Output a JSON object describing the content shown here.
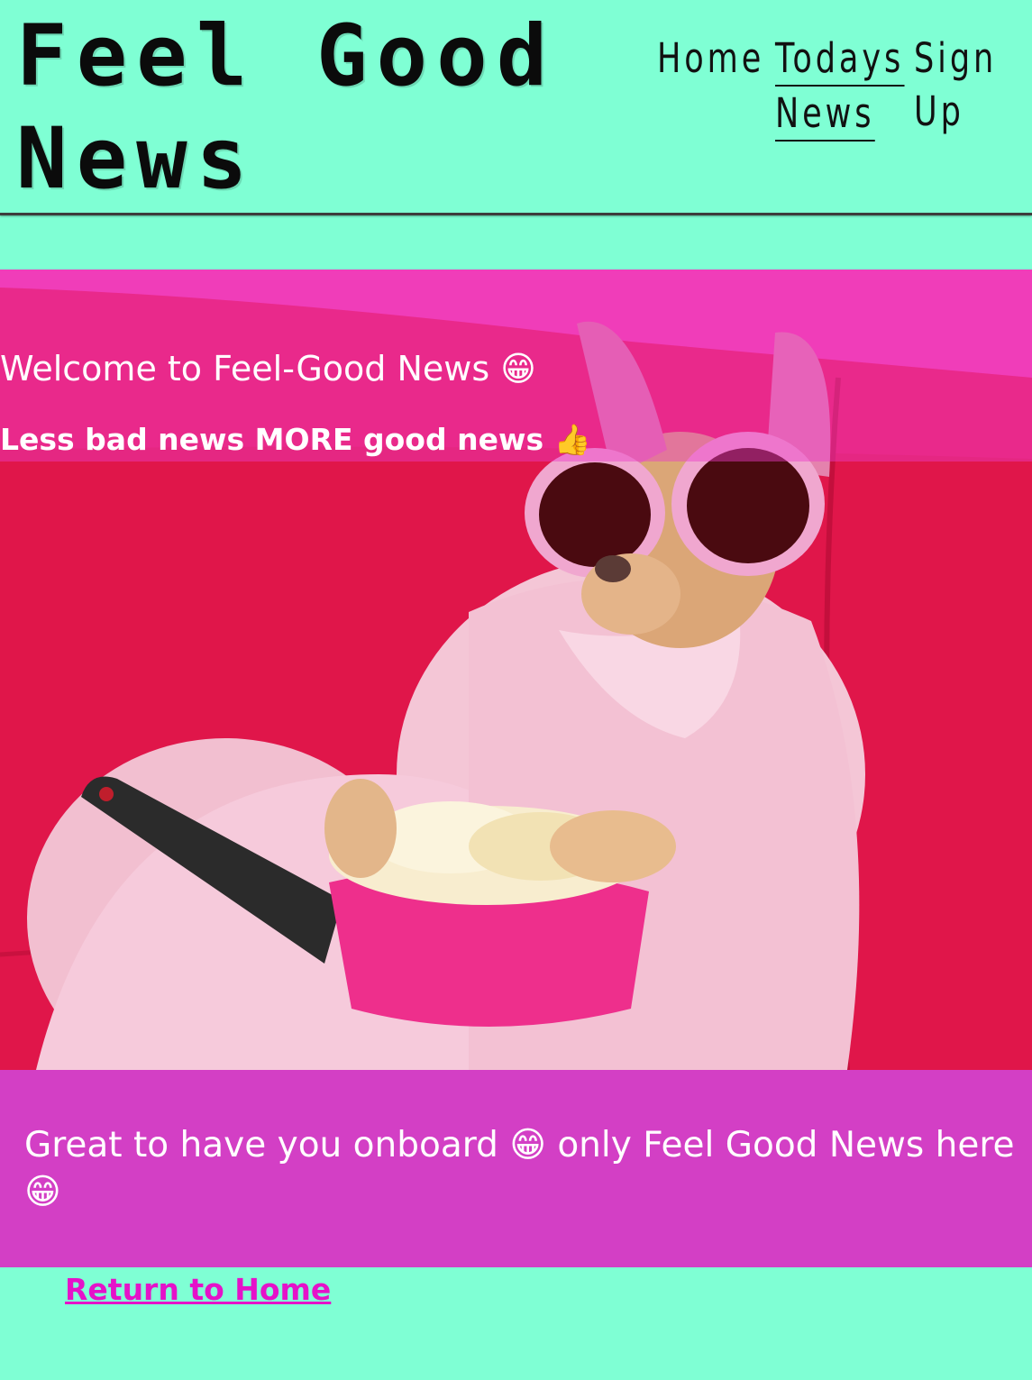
{
  "header": {
    "logo_text": "Feel Good News",
    "nav": {
      "home": "Home",
      "today_line1": "Todays",
      "today_line2": "News",
      "signup_line1": "Sign",
      "signup_line2": "Up"
    }
  },
  "hero": {
    "image_subject": "chihuahua in pink sunglasses and bathrobe holding remote and popcorn on a red sofa",
    "title": "Welcome to Feel-Good News 😁",
    "subtitle": "Less bad news MORE good news 👍"
  },
  "message": {
    "text": "Great to have you onboard 😁 only Feel Good News here 😁"
  },
  "links": {
    "return_home": "Return to Home"
  },
  "colors": {
    "page_bg": "#7fffd4",
    "band_bg": "#d33fc5",
    "link": "#e512c9",
    "sofa": "#e2174b"
  }
}
